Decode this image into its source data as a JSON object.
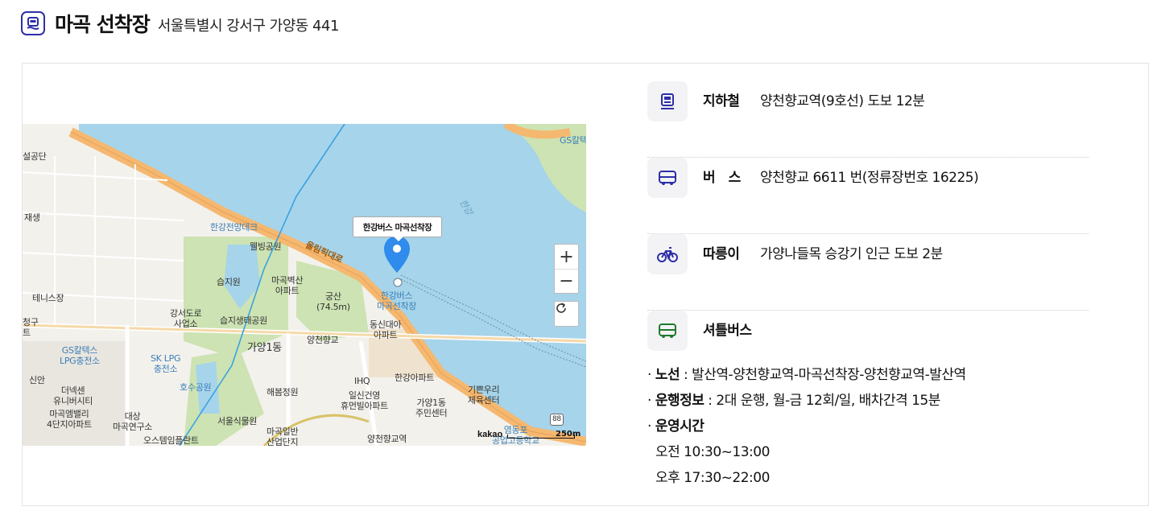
{
  "header": {
    "title": "마곡 선착장",
    "address": "서울특별시 강서구 가양동 441",
    "icon": "ferry-icon"
  },
  "map": {
    "callout": "한강버스 마곡선착장",
    "zoom_in": "+",
    "zoom_out": "−",
    "brand": "kakao",
    "scale": "250m",
    "labels": {
      "l1": "설공단",
      "l2": "재생",
      "l3": "한강전망데크",
      "l4": "웰빙공원",
      "l5": "올림픽대로",
      "l6": "습지원",
      "l7": "마곡벽산\n아파트",
      "l8": "궁산\n(74.5m)",
      "l9": "한강버스\n마곡선착장",
      "l10": "테니스장",
      "l11": "강서도로\n사업소",
      "l12": "습지생태공원",
      "l13": "양천향교",
      "l14": "동신대아\n아파트",
      "l15": "청구\n트",
      "l16": "GS칼텍스\nLPG충전소",
      "l17": "SK LPG\n충전소",
      "l18": "가양1동",
      "l19": "신안",
      "l20": "IHQ",
      "l21": "한강아파트",
      "l22": "기쁜우리\n체육센터",
      "l23": "더넥센\n유니버시티",
      "l24": "호수공원",
      "l25": "해봄정원",
      "l26": "일신건영\n휴먼빌아파트",
      "l27": "가양1동\n주민센터",
      "l28": "마곡엠밸리\n4단지아파트",
      "l29": "대상\n마곡연구소",
      "l30": "서울식물원",
      "l31": "마곡일반\n산업단지",
      "l32": "양천향교역",
      "l33": "오스템임플란트",
      "l34": "염동포\n공업고등학교",
      "l35": "GS칼텍",
      "l36": "한강",
      "l37": "88"
    }
  },
  "transport": [
    {
      "icon": "subway-icon",
      "label": "지하철",
      "text": "양천향교역(9호선) 도보 12분"
    },
    {
      "icon": "bus-icon",
      "label": "버　스",
      "text": "양천향교 6611 번(정류장번호 16225)"
    },
    {
      "icon": "bicycle-icon",
      "label": "따릉이",
      "text": "가양나들목 승강기 인근 도보 2분"
    },
    {
      "icon": "shuttle-bus-icon",
      "label": "셔틀버스",
      "text": ""
    }
  ],
  "shuttle": {
    "route_label": "노선",
    "route": "발산역-양천향교역-마곡선착장-양천향교역-발산역",
    "info_label": "운행정보",
    "info": "2대 운행, 월-금 12회/일, 배차간격 15분",
    "hours_label": "운영시간",
    "am": "오전 10:30~13:00",
    "pm": "오후 17:30~22:00"
  },
  "colors": {
    "accent": "#2d2fa8",
    "water": "#a6d4ea",
    "road": "#f5b870",
    "park": "#cde3b3",
    "marker": "#2f8bec",
    "shuttle": "#1f7a2e"
  }
}
